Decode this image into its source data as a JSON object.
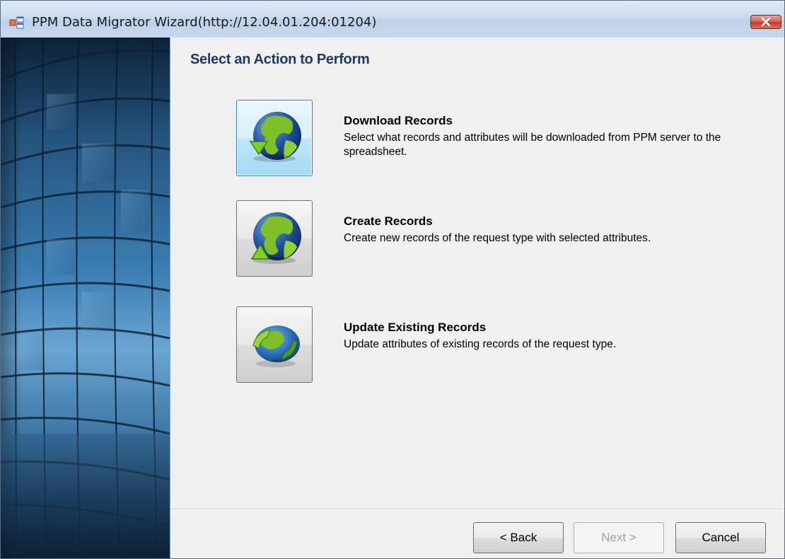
{
  "window": {
    "title": "PPM Data Migrator Wizard(http://12.04.01.204:01204)"
  },
  "main": {
    "page_title": "Select an Action to Perform",
    "actions": [
      {
        "title": "Download Records",
        "description": "Select what records and attributes will be downloaded from PPM server to the spreadsheet.",
        "icon": "globe-download-icon",
        "focused": true
      },
      {
        "title": "Create Records",
        "description": "Create new records of the request type with selected attributes.",
        "icon": "globe-create-icon",
        "focused": false
      },
      {
        "title": "Update Existing Records",
        "description": "Update attributes of existing records of the request type.",
        "icon": "globe-update-icon",
        "focused": false
      }
    ]
  },
  "footer": {
    "back_label": "< Back",
    "next_label": "Next >",
    "cancel_label": "Cancel",
    "next_enabled": false
  },
  "colors": {
    "title_accent": "#1e3964",
    "focus_border": "#3c7fb1"
  }
}
